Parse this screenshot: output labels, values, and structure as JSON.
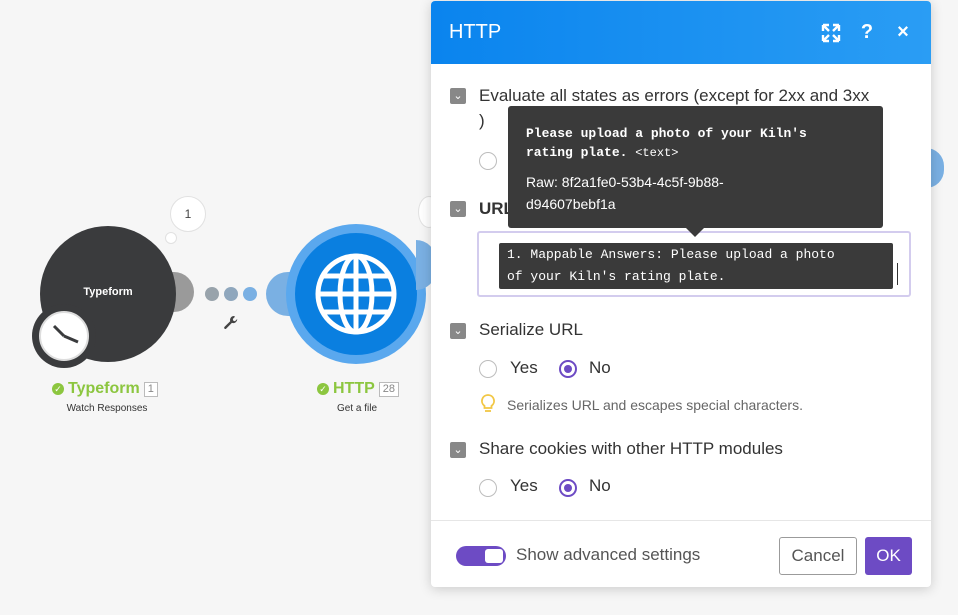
{
  "canvas": {
    "typeform_node": {
      "inner_label": "Typeform",
      "name": "Typeform",
      "count": "1",
      "subtitle": "Watch Responses",
      "bubble_number": "1"
    },
    "http_node": {
      "name": "HTTP",
      "count": "28",
      "subtitle": "Get a file"
    },
    "icons": {
      "typeform": "clock-icon",
      "http": "globe-icon",
      "tool": "wrench-icon",
      "check": "check-icon"
    }
  },
  "dialog": {
    "title": "HTTP",
    "header_icons": {
      "expand": "expand-icon",
      "help": "?",
      "close": "×"
    },
    "sections": {
      "evaluate": {
        "label_line1": "Evaluate all states as errors (except for 2xx and 3xx",
        "label_line2": ")"
      },
      "url": {
        "label": "URL",
        "pill_text_line1": "1. Mappable Answers: Please upload a photo",
        "pill_text_line2": "of your Kiln's rating plate."
      },
      "serialize": {
        "label": "Serialize URL",
        "yes": "Yes",
        "no": "No",
        "selected": "No",
        "hint": "Serializes URL and escapes special characters."
      },
      "cookies": {
        "label": "Share cookies with other HTTP modules",
        "yes": "Yes",
        "no": "No",
        "selected": "No"
      }
    },
    "tooltip": {
      "title_line1": "Please upload a photo of your Kiln's",
      "title_line2": "rating plate.",
      "type": "<text>",
      "raw_line1": "Raw: 8f2a1fe0-53b4-4c5f-9b88-",
      "raw_line2": "d94607bebf1a"
    },
    "footer": {
      "advanced_label": "Show advanced settings",
      "advanced_on": true,
      "cancel": "Cancel",
      "ok": "OK"
    }
  },
  "colors": {
    "header_blue": "#0a84ee",
    "accent_purple": "#6d4bc4",
    "success_green": "#8cc63f",
    "typeform_dark": "#3a3b3d",
    "http_blue": "#0a7fe0"
  }
}
